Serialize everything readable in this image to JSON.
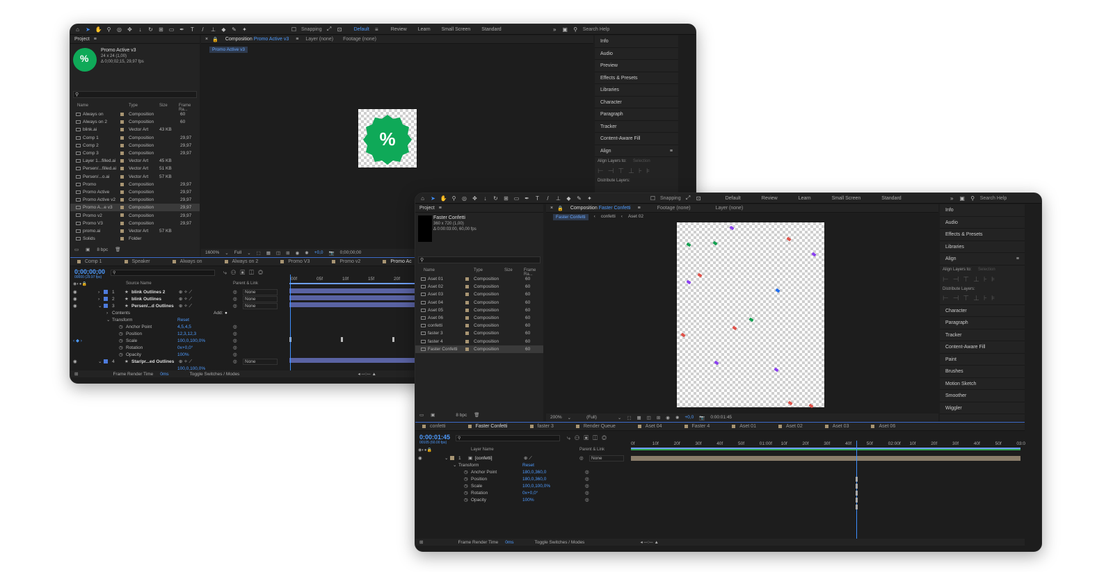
{
  "w1": {
    "toolbar": {
      "snapping": "Snapping",
      "workspaces": [
        "Default",
        "Review",
        "Learn",
        "Small Screen",
        "Standard"
      ],
      "search": "Search Help"
    },
    "project": {
      "title": "Project",
      "comp_name": "Promo Active v3",
      "comp_size": "24 x 24 (1,00)",
      "comp_dur": "Δ 0;00;02;15, 29,97 fps",
      "cols": [
        "Name",
        "Type",
        "Size",
        "Frame Ra..."
      ],
      "items": [
        {
          "name": "Always on",
          "type": "Composition",
          "size": "",
          "fr": "60"
        },
        {
          "name": "Always on 2",
          "type": "Composition",
          "size": "",
          "fr": "60"
        },
        {
          "name": "blink.ai",
          "type": "Vector Art",
          "size": "43 KB",
          "fr": ""
        },
        {
          "name": "Comp 1",
          "type": "Composition",
          "size": "",
          "fr": "29,97"
        },
        {
          "name": "Comp 2",
          "type": "Composition",
          "size": "",
          "fr": "29,97"
        },
        {
          "name": "Comp 3",
          "type": "Composition",
          "size": "",
          "fr": "29,97"
        },
        {
          "name": "Layer 1...filled.ai",
          "type": "Vector Art",
          "size": "45 KB",
          "fr": ""
        },
        {
          "name": "Persen/...filled.ai",
          "type": "Vector Art",
          "size": "51 KB",
          "fr": ""
        },
        {
          "name": "Persen/...o.ai",
          "type": "Vector Art",
          "size": "57 KB",
          "fr": ""
        },
        {
          "name": "Promo",
          "type": "Composition",
          "size": "",
          "fr": "29,97"
        },
        {
          "name": "Promo Active",
          "type": "Composition",
          "size": "",
          "fr": "29,97"
        },
        {
          "name": "Promo Active v2",
          "type": "Composition",
          "size": "",
          "fr": "29,97"
        },
        {
          "name": "Promo A...e v3",
          "type": "Composition",
          "size": "",
          "fr": "29,97"
        },
        {
          "name": "Promo v2",
          "type": "Composition",
          "size": "",
          "fr": "29,97"
        },
        {
          "name": "Promo V3",
          "type": "Composition",
          "size": "",
          "fr": "29,97"
        },
        {
          "name": "promo.ai",
          "type": "Vector Art",
          "size": "57 KB",
          "fr": ""
        },
        {
          "name": "Solids",
          "type": "Folder",
          "size": "",
          "fr": ""
        }
      ],
      "bpc": "8 bpc"
    },
    "comp": {
      "label": "Composition",
      "name": "Promo Active v3",
      "layer": "Layer (none)",
      "footage": "Footage (none)",
      "subtab": "Promo Active v3",
      "zoom": "1600%",
      "res": "Full",
      "exposure": "+0,0",
      "time": "0;00;00;00"
    },
    "right": [
      "Info",
      "Audio",
      "Preview",
      "Effects & Presets",
      "Libraries",
      "Character",
      "Paragraph",
      "Tracker",
      "Content-Aware Fill"
    ],
    "align": {
      "title": "Align",
      "align_to": "Align Layers to:",
      "selection": "Selection",
      "distribute": "Distribute Layers:"
    },
    "tl": {
      "tabs": [
        "Comp 1",
        "Speaker",
        "Always on",
        "Always on 2",
        "Promo V3",
        "Promo v2",
        "Promo Ac"
      ],
      "time": "0;00;00;00",
      "fps": "00000 (29.97 fps)",
      "colsrc": "Source Name",
      "colparent": "Parent & Link",
      "add": "Add:",
      "layers": [
        {
          "num": "1",
          "name": "blink Outlines 2",
          "parent": "None"
        },
        {
          "num": "2",
          "name": "blink Outlines",
          "parent": "None"
        },
        {
          "num": "3",
          "name": "Persen/...d Outlines",
          "parent": "None"
        }
      ],
      "contents": "Contents",
      "transform": "Transform",
      "reset": "Reset",
      "props": [
        {
          "name": "Anchor Point",
          "val": "4,5,4,5"
        },
        {
          "name": "Position",
          "val": "12,3,12,3"
        },
        {
          "name": "Scale",
          "val": "100,0,100,0%"
        },
        {
          "name": "Rotation",
          "val": "0x+0,0°"
        },
        {
          "name": "Opacity",
          "val": "100%"
        }
      ],
      "layer4": {
        "num": "4",
        "name": "Star/pr...ed Outlines",
        "parent": "None"
      },
      "scale_next": "100,0,100,0%",
      "ruler": [
        "00f",
        "05f",
        "10f",
        "15f",
        "20f"
      ],
      "foot_render": "Frame Render Time",
      "foot_ms": "0ms",
      "foot_toggle": "Toggle Switches / Modes"
    }
  },
  "w2": {
    "toolbar": {
      "snapping": "Snapping",
      "workspaces": [
        "Default",
        "Review",
        "Learn",
        "Small Screen",
        "Standard"
      ],
      "search": "Search Help"
    },
    "project": {
      "title": "Project",
      "comp_name": "Faster Confetti",
      "comp_size": "360 x 720 (1,00)",
      "comp_dur": "Δ 0:00:03:00, 60,00 fps",
      "cols": [
        "Name",
        "Type",
        "Size",
        "Frame Ra..."
      ],
      "items": [
        {
          "name": "Aset 01",
          "type": "Composition",
          "fr": "60"
        },
        {
          "name": "Aset 02",
          "type": "Composition",
          "fr": "60"
        },
        {
          "name": "Aset 03",
          "type": "Composition",
          "fr": "60"
        },
        {
          "name": "Aset 04",
          "type": "Composition",
          "fr": "60"
        },
        {
          "name": "Aset 05",
          "type": "Composition",
          "fr": "60"
        },
        {
          "name": "Aset 06",
          "type": "Composition",
          "fr": "60"
        },
        {
          "name": "confetti",
          "type": "Composition",
          "fr": "60"
        },
        {
          "name": "faster 3",
          "type": "Composition",
          "fr": "60"
        },
        {
          "name": "faster 4",
          "type": "Composition",
          "fr": "60"
        },
        {
          "name": "Faster Confetti",
          "type": "Composition",
          "fr": "60"
        }
      ],
      "bpc": "8 bpc"
    },
    "comp": {
      "label": "Composition",
      "name": "Faster Confetti",
      "footage": "Footage (none)",
      "layer": "Layer (none)",
      "crumbs": [
        "Faster Confetti",
        "confetti",
        "Aset 02"
      ],
      "zoom": "200%",
      "res": "(Full)",
      "exposure": "+0,0",
      "time": "0:00:01:45"
    },
    "right": [
      "Info",
      "Audio",
      "Effects & Presets",
      "Libraries"
    ],
    "align": {
      "title": "Align",
      "align_to": "Align Layers to:",
      "selection": "Selection",
      "distribute": "Distribute Layers:"
    },
    "right2": [
      "Character",
      "Paragraph",
      "Tracker",
      "Content-Aware Fill",
      "Paint",
      "Brushes",
      "Motion Sketch",
      "Smoother",
      "Wiggler"
    ],
    "tl": {
      "tabs": [
        "confetti",
        "Faster Confetti",
        "faster 3",
        "Render Queue",
        "Aset 04",
        "Faster 4",
        "Aset 01",
        "Aset 02",
        "Aset 03",
        "Aset 06"
      ],
      "time": "0:00:01:45",
      "fps": "00105 (60.00 fps)",
      "collayer": "Layer Name",
      "colparent": "Parent & Link",
      "layer": {
        "num": "1",
        "name": "[confetti]",
        "parent": "None"
      },
      "transform": "Transform",
      "reset": "Reset",
      "props": [
        {
          "name": "Anchor Point",
          "val": "180,0,360,0"
        },
        {
          "name": "Position",
          "val": "180,0,360,0"
        },
        {
          "name": "Scale",
          "val": "100,0,100,0%"
        },
        {
          "name": "Rotation",
          "val": "0x+0,0°"
        },
        {
          "name": "Opacity",
          "val": "100%"
        }
      ],
      "ruler": [
        "0f",
        "10f",
        "20f",
        "30f",
        "40f",
        "50f",
        "01:00f",
        "10f",
        "20f",
        "30f",
        "40f",
        "50f",
        "02:00f",
        "10f",
        "20f",
        "30f",
        "40f",
        "50f",
        "03:0"
      ],
      "foot_render": "Frame Render Time",
      "foot_ms": "0ms",
      "foot_toggle": "Toggle Switches / Modes"
    }
  },
  "colors": {
    "accent": "#4e9bff",
    "badge": "#0fa958",
    "layerbar": "#5a63a3",
    "layerbar2": "#8a7d6a"
  }
}
